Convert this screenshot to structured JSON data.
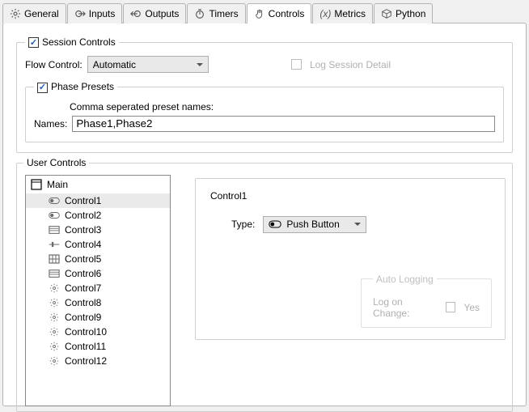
{
  "tabs": [
    {
      "label": "General"
    },
    {
      "label": "Inputs"
    },
    {
      "label": "Outputs"
    },
    {
      "label": "Timers"
    },
    {
      "label": "Controls"
    },
    {
      "label": "Metrics"
    },
    {
      "label": "Python"
    }
  ],
  "active_tab": "Controls",
  "session": {
    "legend": "Session Controls",
    "flow_control_label": "Flow Control:",
    "flow_control_value": "Automatic",
    "log_detail_label": "Log Session Detail",
    "phase": {
      "legend": "Phase Presets",
      "hint": "Comma seperated preset names:",
      "names_label": "Names:",
      "names_value": "Phase1,Phase2"
    }
  },
  "user_controls": {
    "legend": "User Controls",
    "root": "Main",
    "items": [
      {
        "label": "Control1",
        "icon": "toggle",
        "selected": true
      },
      {
        "label": "Control2",
        "icon": "toggle"
      },
      {
        "label": "Control3",
        "icon": "menu"
      },
      {
        "label": "Control4",
        "icon": "slider"
      },
      {
        "label": "Control5",
        "icon": "grid"
      },
      {
        "label": "Control6",
        "icon": "menu"
      },
      {
        "label": "Control7",
        "icon": "sun"
      },
      {
        "label": "Control8",
        "icon": "sun"
      },
      {
        "label": "Control9",
        "icon": "sun"
      },
      {
        "label": "Control10",
        "icon": "sun"
      },
      {
        "label": "Control11",
        "icon": "sun"
      },
      {
        "label": "Control12",
        "icon": "sun"
      }
    ],
    "details": {
      "title": "Control1",
      "type_label": "Type:",
      "type_value": "Push Button",
      "autolog_legend": "Auto Logging",
      "autolog_label": "Log on Change:",
      "autolog_yes": "Yes"
    }
  }
}
